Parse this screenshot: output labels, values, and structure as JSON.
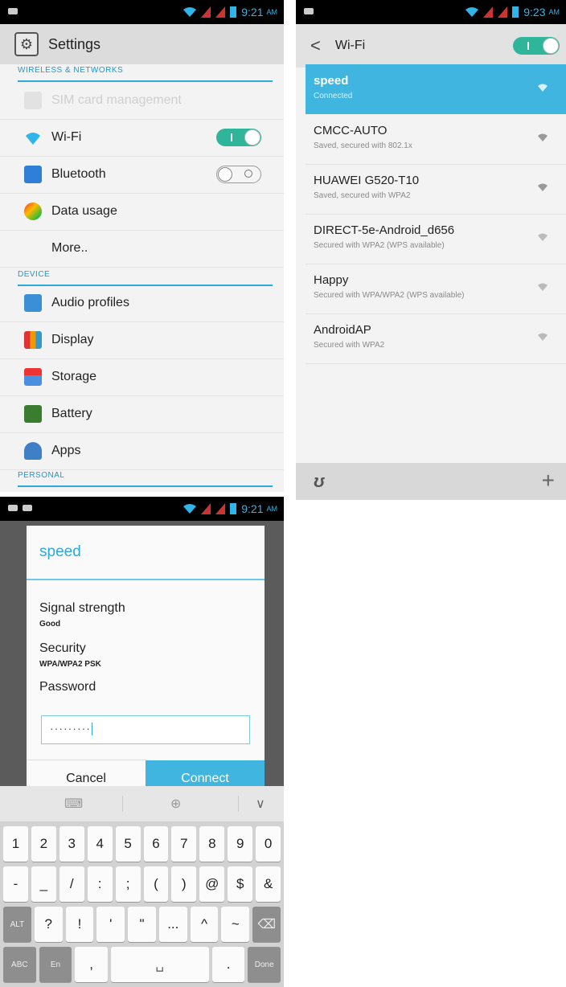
{
  "settings": {
    "status_time": "9:21",
    "status_ampm": "AM",
    "title": "Settings",
    "sections": {
      "wireless": "WIRELESS & NETWORKS",
      "device": "DEVICE",
      "personal": "PERSONAL"
    },
    "items": {
      "sim": "SIM card management",
      "wifi": "Wi-Fi",
      "bluetooth": "Bluetooth",
      "data_usage": "Data usage",
      "more": "More..",
      "audio": "Audio profiles",
      "display": "Display",
      "storage": "Storage",
      "battery": "Battery",
      "apps": "Apps"
    },
    "wifi_toggle": "on",
    "bluetooth_toggle": "off"
  },
  "wifi": {
    "status_time": "9:23",
    "status_ampm": "AM",
    "title": "Wi-Fi",
    "networks": [
      {
        "name": "speed",
        "sub": "Connected"
      },
      {
        "name": "CMCC-AUTO",
        "sub": "Saved, secured with 802.1x"
      },
      {
        "name": "HUAWEI G520-T10",
        "sub": "Saved, secured with WPA2"
      },
      {
        "name": "DIRECT-5e-Android_d656",
        "sub": "Secured with WPA2 (WPS available)"
      },
      {
        "name": "Happy",
        "sub": "Secured with WPA/WPA2 (WPS available)"
      },
      {
        "name": "AndroidAP",
        "sub": "Secured with WPA2"
      }
    ]
  },
  "dialog": {
    "status_time": "9:21",
    "status_ampm": "AM",
    "title": "speed",
    "signal_label": "Signal strength",
    "signal_value": "Good",
    "security_label": "Security",
    "security_value": "WPA/WPA2 PSK",
    "password_label": "Password",
    "password_value": "·········",
    "cancel": "Cancel",
    "connect": "Connect"
  },
  "keyboard": {
    "row1": [
      "1",
      "2",
      "3",
      "4",
      "5",
      "6",
      "7",
      "8",
      "9",
      "0"
    ],
    "row2": [
      "-",
      "_",
      "/",
      ":",
      ";",
      "(",
      ")",
      "@",
      "$",
      "&"
    ],
    "row3": [
      "ALT",
      "?",
      "!",
      "'",
      "\"",
      "...",
      "^",
      "~",
      "⌫"
    ],
    "row4": [
      "ABC",
      "En",
      ",",
      "␣",
      ".",
      "Done"
    ],
    "accent": "#3fb5e0"
  }
}
